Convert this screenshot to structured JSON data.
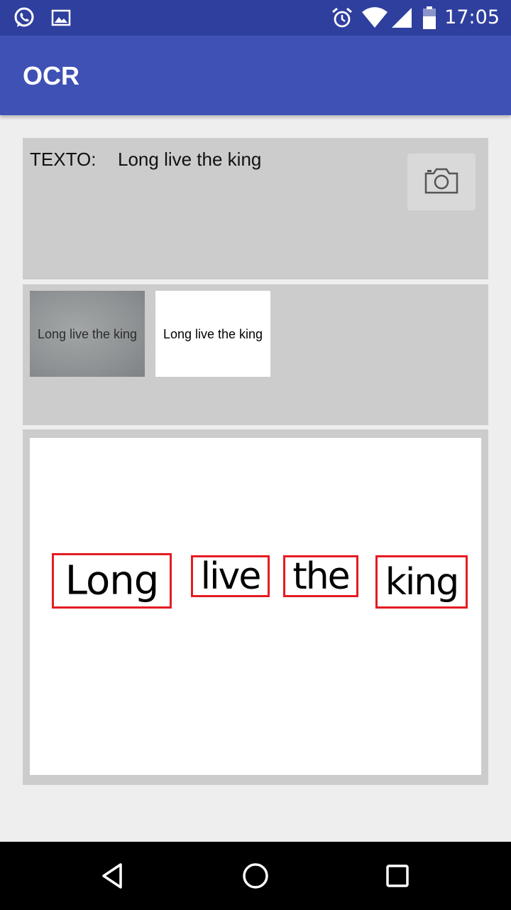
{
  "status_bar": {
    "time": "17:05",
    "left_icons": [
      "whatsapp-icon",
      "image-icon"
    ],
    "right_icons": [
      "alarm-icon",
      "wifi-icon",
      "signal-icon",
      "battery-icon"
    ]
  },
  "app_bar": {
    "title": "OCR",
    "color": "#3f51b5"
  },
  "text_panel": {
    "label": "TEXTO:",
    "value": "Long live the king",
    "camera_button_icon": "camera-icon"
  },
  "thumbnails": {
    "photo_text": "Long live the king",
    "processed_text": "Long live the king"
  },
  "result": {
    "box_color": "#e51c23",
    "words": [
      "Long",
      "live",
      "the",
      "king"
    ]
  },
  "nav_bar": {
    "icons": [
      "back-icon",
      "home-icon",
      "recents-icon"
    ]
  }
}
